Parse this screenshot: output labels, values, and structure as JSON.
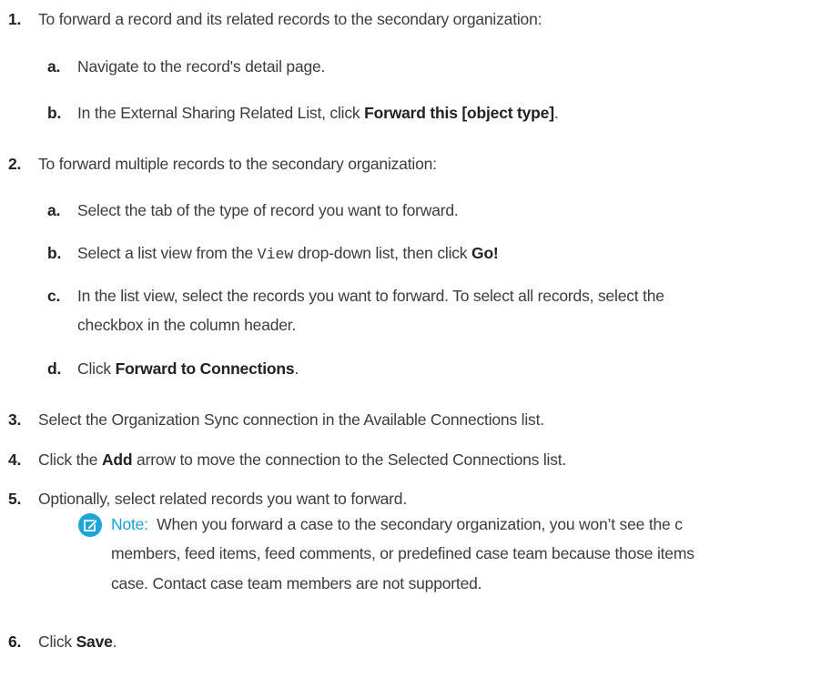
{
  "steps": [
    {
      "num": "1.",
      "text": "To forward a record and its related records to the secondary organization:",
      "substeps": [
        {
          "letter": "a.",
          "text": "Navigate to the record's detail page."
        },
        {
          "letter": "b.",
          "pre": "In the External Sharing Related List, click ",
          "bold": "Forward this [object type]",
          "post": "."
        }
      ]
    },
    {
      "num": "2.",
      "text": "To forward multiple records to the secondary organization:",
      "substeps": [
        {
          "letter": "a.",
          "text": "Select the tab of the type of record you want to forward."
        },
        {
          "letter": "b.",
          "pre": "Select a list view from the ",
          "code": "View",
          "mid": " drop-down list, then click ",
          "bold": "Go!"
        },
        {
          "letter": "c.",
          "line1": "In the list view, select the records you want to forward. To select all records, select the",
          "line2": "checkbox in the column header."
        },
        {
          "letter": "d.",
          "pre": "Click ",
          "bold": "Forward to Connections",
          "post": "."
        }
      ]
    },
    {
      "num": "3.",
      "text": "Select the Organization Sync connection in the Available Connections list."
    },
    {
      "num": "4.",
      "pre": "Click the ",
      "bold": "Add",
      "post": " arrow to move the connection to the Selected Connections list."
    },
    {
      "num": "5.",
      "text": "Optionally, select related records you want to forward."
    },
    {
      "num": "6.",
      "pre": "Click ",
      "bold": "Save",
      "post": "."
    }
  ],
  "note": {
    "icon": "edit-note-icon",
    "label": "Note:",
    "line1": "When you forward a case to the secondary organization, you won’t see the c",
    "line2": "members, feed items, feed comments, or predefined case team because those items",
    "line3": "case. Contact case team members are not supported."
  },
  "colors": {
    "text": "#3c3c3c",
    "note_accent": "#1da4d9"
  }
}
